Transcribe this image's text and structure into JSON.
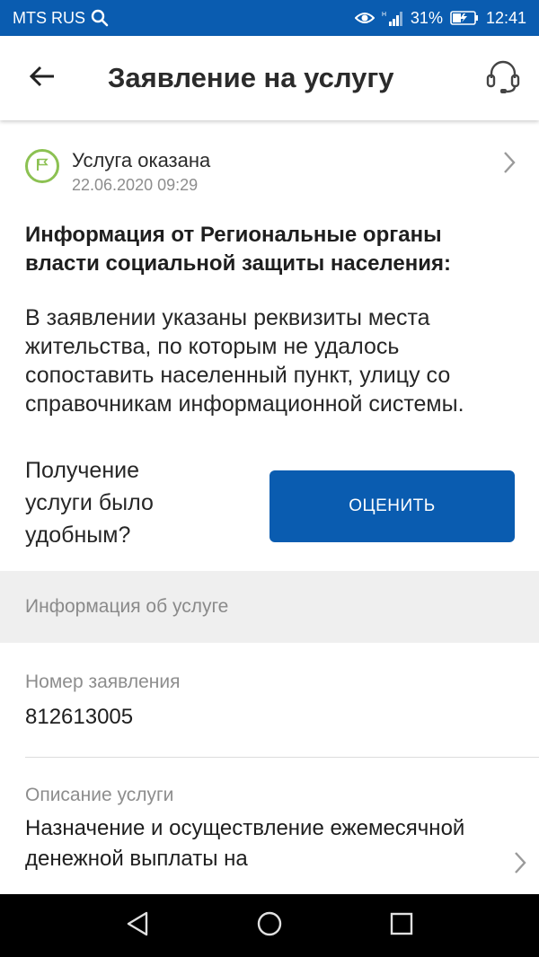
{
  "status_bar": {
    "carrier": "MTS RUS",
    "battery": "31%",
    "time": "12:41"
  },
  "app_bar": {
    "title": "Заявление на услугу"
  },
  "status": {
    "title": "Услуга оказана",
    "date": "22.06.2020 09:29"
  },
  "info": {
    "heading": "Информация от Региональные органы власти социальной защиты населения:",
    "text": "В заявлении указаны реквизиты места жительства, по которым не удалось сопоставить населенный пункт, улицу со справочникам информационной системы."
  },
  "rating": {
    "question": "Получение услуги было удобным?",
    "button_label": "ОЦЕНИТЬ"
  },
  "service_info": {
    "section_title": "Информация об услуге",
    "number_label": "Номер заявления",
    "number_value": "812613005",
    "description_label": "Описание услуги",
    "description_value": "Назначение и осуществление ежемесячной денежной выплаты на"
  },
  "colors": {
    "brand_blue": "#0a5cb0",
    "status_green": "#8cc152"
  }
}
